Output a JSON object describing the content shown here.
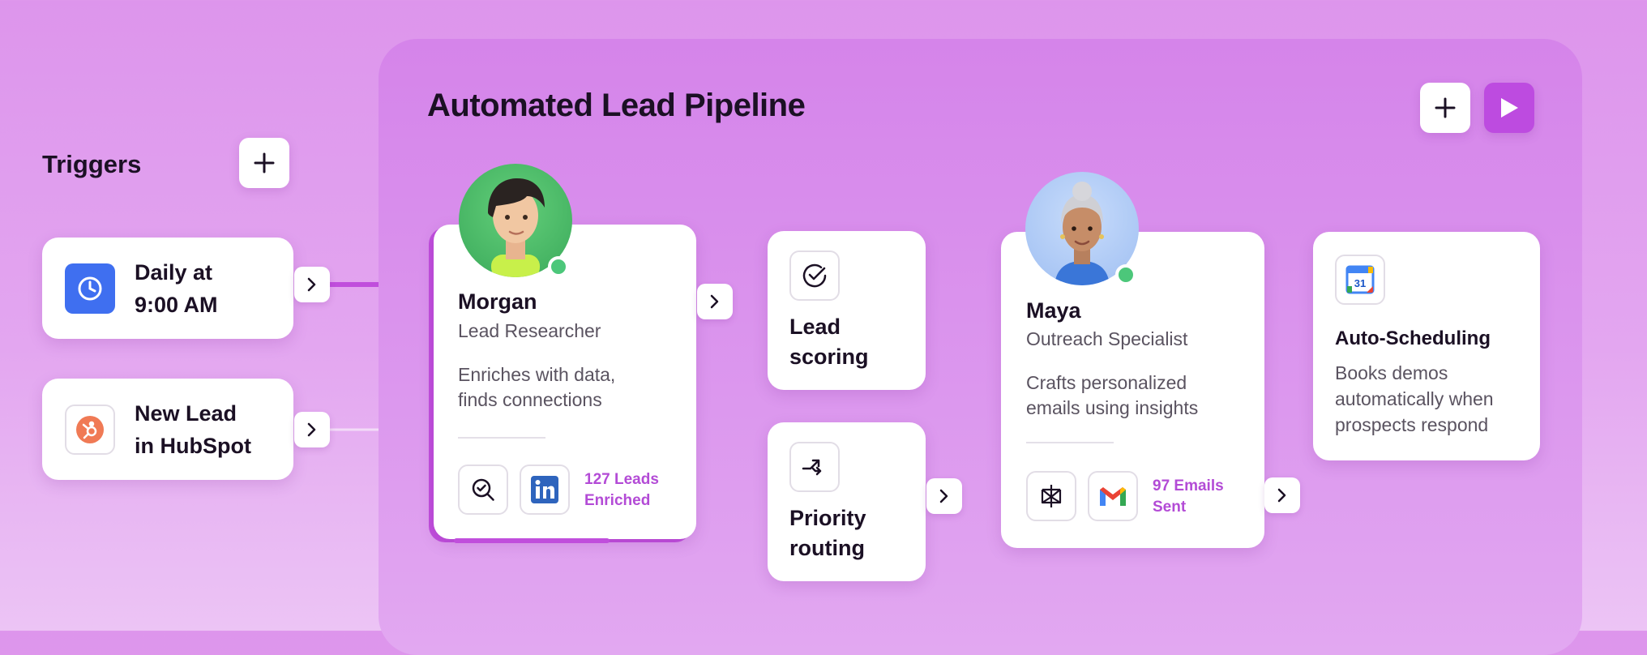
{
  "header": {
    "title": "Automated Lead Pipeline"
  },
  "triggers": {
    "label": "Triggers",
    "items": [
      {
        "line1": "Daily at",
        "line2": "9:00 AM",
        "icon": "clock-icon"
      },
      {
        "line1": "New Lead",
        "line2": "in HubSpot",
        "icon": "hubspot-icon"
      }
    ]
  },
  "agents": {
    "morgan": {
      "name": "Morgan",
      "role": "Lead Researcher",
      "desc1": "Enriches with data,",
      "desc2": "finds connections",
      "stat1": "127 Leads",
      "stat2": "Enriched",
      "tools": [
        "search-check-icon",
        "linkedin-icon"
      ]
    },
    "maya": {
      "name": "Maya",
      "role": "Outreach Specialist",
      "desc1": "Crafts personalized",
      "desc2": "emails using insights",
      "stat1": "97 Emails",
      "stat2": "Sent",
      "tools": [
        "perplexity-icon",
        "gmail-icon"
      ]
    }
  },
  "steps": {
    "lead_scoring": {
      "line1": "Lead",
      "line2": "scoring"
    },
    "priority_routing": {
      "line1": "Priority",
      "line2": "routing"
    },
    "auto_scheduling": {
      "title": "Auto-Scheduling",
      "desc1": "Books demos",
      "desc2": "automatically when",
      "desc3": "prospects respond",
      "calendar_day": "31"
    }
  },
  "colors": {
    "accent": "#b34bd6",
    "clock_bg": "#3f6ff0",
    "hubspot": "#f07a55",
    "online": "#4cc77a"
  }
}
